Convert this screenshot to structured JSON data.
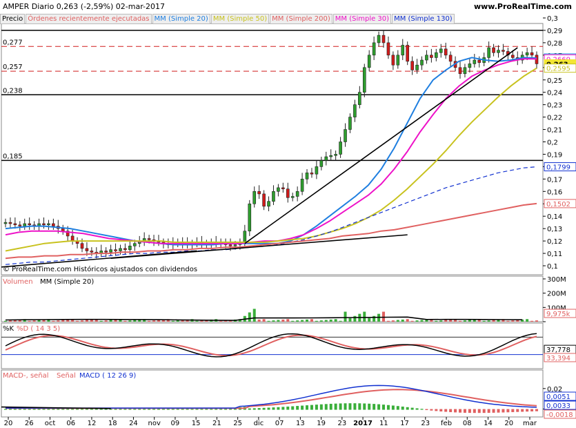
{
  "header": {
    "ticker_line": "AMPER   Diario   0,263 (-2,59%)   02-mar-2017",
    "site": "www.ProRealTime.com"
  },
  "labels": {
    "price_panel": "Precio",
    "ordenes": "Órdenes recientemente ejecutadas",
    "mm20": "MM (Simple 20)",
    "mm50": "MM (Simple 50)",
    "mm200": "MM (Simple 200)",
    "mm30": "MM (Simple 30)",
    "mm130": "MM (Simple 130)",
    "copyright": "© ProRealTime.com  Históricos ajustados con dividendos",
    "volumen": "Volumen",
    "vol_mm20": "MM (Simple 20)",
    "stoch_k": "%K",
    "stoch_d": "%D ( 14 3 5)",
    "macd_label": "MACD-, señal",
    "senal": "Señal",
    "macd_params": "MACD ( 12 26 9)"
  },
  "colors": {
    "candle_up": "#2e9e2e",
    "candle_down": "#d11b1b",
    "mm20": "#1f7fe0",
    "mm30": "#ee12c8",
    "mm50": "#c8c21e",
    "mm130": "#1030d0",
    "mm200": "#e06060",
    "lastprice": "#f3e633",
    "vol_up": "#3aae3a",
    "vol_down": "#e06060"
  },
  "chart_data": [
    {
      "id": "price",
      "type": "candlestick",
      "ylim": [
        0.1,
        0.3
      ],
      "yticks": [
        "0,3",
        "0,29",
        "0,28",
        "0,27",
        "0,26",
        "0,25",
        "0,24",
        "0,23",
        "0,22",
        "0,21",
        "0,2",
        "0,19",
        "0,18",
        "0,17",
        "0,16",
        "0,15",
        "0,14",
        "0,13",
        "0,12",
        "0,11",
        "0,1"
      ],
      "xticks": [
        "20",
        "26",
        "oct",
        "06",
        "12",
        "18",
        "24",
        "nov",
        "09",
        "15",
        "21",
        "25",
        "dic",
        "07",
        "13",
        "19",
        "23",
        "2017",
        "11",
        "17",
        "23",
        "feb",
        "08",
        "14",
        "20",
        "mar"
      ],
      "level_lines": [
        {
          "value": 0.29,
          "label": "",
          "style": "solid"
        },
        {
          "value": 0.277,
          "label": "0,277",
          "style": "dashed-red"
        },
        {
          "value": 0.257,
          "label": "0,257",
          "style": "dashed-red"
        },
        {
          "value": 0.238,
          "label": "0,238",
          "style": "solid"
        },
        {
          "value": 0.185,
          "label": "0,185",
          "style": "solid"
        }
      ],
      "value_tags": [
        {
          "value": 0.2677,
          "text": "0,2677",
          "color": "#1f7fe0"
        },
        {
          "value": 0.2669,
          "text": "0,2669",
          "color": "#ee12c8"
        },
        {
          "value": 0.263,
          "text": "0,263",
          "color": "#f3e633"
        },
        {
          "value": 0.2595,
          "text": "0,2595",
          "color": "#c8c21e"
        },
        {
          "value": 0.1799,
          "text": "0,1799",
          "color": "#1030d0"
        },
        {
          "value": 0.1502,
          "text": "0,1502",
          "color": "#e06060"
        }
      ],
      "candles_close": [
        0.135,
        0.134,
        0.133,
        0.132,
        0.134,
        0.133,
        0.132,
        0.134,
        0.133,
        0.134,
        0.132,
        0.13,
        0.128,
        0.124,
        0.12,
        0.118,
        0.114,
        0.112,
        0.111,
        0.11,
        0.112,
        0.111,
        0.113,
        0.112,
        0.114,
        0.113,
        0.116,
        0.118,
        0.12,
        0.122,
        0.121,
        0.12,
        0.119,
        0.118,
        0.117,
        0.118,
        0.119,
        0.118,
        0.117,
        0.118,
        0.119,
        0.118,
        0.117,
        0.118,
        0.119,
        0.118,
        0.117,
        0.116,
        0.117,
        0.118,
        0.128,
        0.15,
        0.16,
        0.158,
        0.148,
        0.152,
        0.16,
        0.163,
        0.162,
        0.155,
        0.156,
        0.16,
        0.17,
        0.175,
        0.174,
        0.18,
        0.185,
        0.188,
        0.189,
        0.19,
        0.2,
        0.21,
        0.22,
        0.23,
        0.24,
        0.26,
        0.27,
        0.28,
        0.286,
        0.28,
        0.27,
        0.262,
        0.27,
        0.278,
        0.265,
        0.258,
        0.262,
        0.266,
        0.27,
        0.268,
        0.272,
        0.275,
        0.27,
        0.265,
        0.26,
        0.255,
        0.26,
        0.263,
        0.266,
        0.264,
        0.268,
        0.276,
        0.272,
        0.274,
        0.273,
        0.27,
        0.268,
        0.266,
        0.27,
        0.272,
        0.27,
        0.263
      ],
      "series": [
        {
          "name": "MM (Simple 20)",
          "values": [
            0.13,
            0.131,
            0.132,
            0.132,
            0.131,
            0.13,
            0.128,
            0.126,
            0.124,
            0.122,
            0.12,
            0.119,
            0.118,
            0.117,
            0.117,
            0.117,
            0.117,
            0.118,
            0.118,
            0.118,
            0.118,
            0.118,
            0.12,
            0.125,
            0.132,
            0.14,
            0.148,
            0.156,
            0.165,
            0.178,
            0.195,
            0.215,
            0.235,
            0.25,
            0.258,
            0.265,
            0.268,
            0.266,
            0.265,
            0.266,
            0.268,
            0.2677
          ]
        },
        {
          "name": "MM (Simple 30)",
          "values": [
            0.125,
            0.127,
            0.128,
            0.128,
            0.128,
            0.127,
            0.126,
            0.124,
            0.122,
            0.121,
            0.12,
            0.119,
            0.118,
            0.118,
            0.118,
            0.118,
            0.118,
            0.118,
            0.118,
            0.119,
            0.12,
            0.12,
            0.122,
            0.125,
            0.13,
            0.136,
            0.143,
            0.15,
            0.157,
            0.166,
            0.178,
            0.192,
            0.208,
            0.222,
            0.235,
            0.245,
            0.253,
            0.258,
            0.262,
            0.265,
            0.267,
            0.2669
          ]
        },
        {
          "name": "MM (Simple 50)",
          "values": [
            0.112,
            0.114,
            0.116,
            0.118,
            0.119,
            0.12,
            0.12,
            0.12,
            0.12,
            0.12,
            0.12,
            0.12,
            0.12,
            0.119,
            0.119,
            0.119,
            0.119,
            0.119,
            0.119,
            0.119,
            0.119,
            0.12,
            0.121,
            0.122,
            0.124,
            0.127,
            0.13,
            0.134,
            0.139,
            0.145,
            0.153,
            0.162,
            0.172,
            0.182,
            0.193,
            0.205,
            0.216,
            0.226,
            0.236,
            0.245,
            0.253,
            0.2595
          ]
        },
        {
          "name": "MM (Simple 130)",
          "values": [
            0.101,
            0.102,
            0.103,
            0.103,
            0.104,
            0.105,
            0.106,
            0.107,
            0.108,
            0.109,
            0.11,
            0.11,
            0.111,
            0.111,
            0.112,
            0.112,
            0.113,
            0.113,
            0.114,
            0.115,
            0.116,
            0.117,
            0.119,
            0.121,
            0.124,
            0.127,
            0.131,
            0.135,
            0.139,
            0.143,
            0.147,
            0.151,
            0.155,
            0.159,
            0.163,
            0.166,
            0.169,
            0.172,
            0.175,
            0.177,
            0.179,
            0.1799
          ]
        },
        {
          "name": "MM (Simple 200)",
          "values": [
            0.106,
            0.107,
            0.107,
            0.108,
            0.108,
            0.109,
            0.109,
            0.11,
            0.11,
            0.111,
            0.111,
            0.112,
            0.112,
            0.113,
            0.113,
            0.114,
            0.114,
            0.115,
            0.115,
            0.116,
            0.117,
            0.118,
            0.119,
            0.12,
            0.121,
            0.122,
            0.124,
            0.125,
            0.126,
            0.128,
            0.129,
            0.131,
            0.133,
            0.135,
            0.137,
            0.139,
            0.141,
            0.143,
            0.145,
            0.147,
            0.149,
            0.1502
          ]
        }
      ]
    },
    {
      "id": "volume",
      "type": "bar",
      "ylim": [
        0,
        300
      ],
      "yticks": [
        "300M",
        "200M",
        "100M",
        "0"
      ],
      "last_value_tag": "9,975k"
    },
    {
      "id": "stochastic",
      "type": "line",
      "ylim": [
        0,
        100
      ],
      "tags": [
        "37,778",
        "33,394"
      ]
    },
    {
      "id": "macd",
      "type": "line",
      "ylim": [
        -0.005,
        0.03
      ],
      "yticks": [
        "0,02",
        "0"
      ],
      "tags": [
        "0,0051",
        "0,0033",
        "-0,0018"
      ]
    }
  ]
}
